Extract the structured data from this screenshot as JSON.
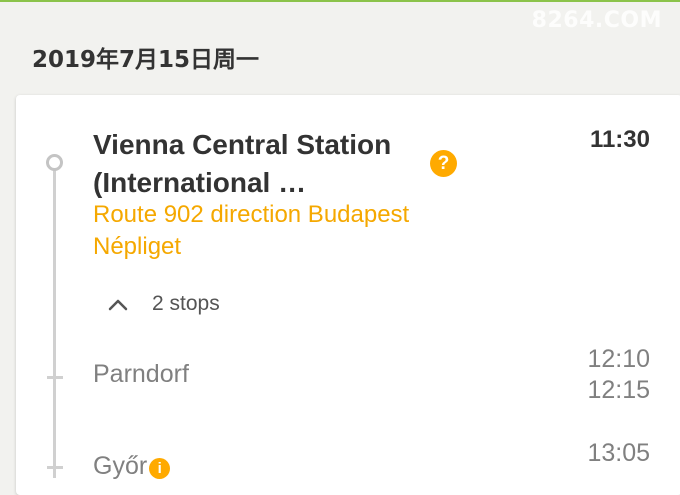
{
  "watermark": "8264.COM",
  "date_header": "2019年7月15日周一",
  "departure": {
    "station": "Vienna Central Station (International …",
    "time": "11:30",
    "help_icon": "?",
    "route": "Route 902 direction Budapest Népliget"
  },
  "stops_toggle": {
    "label": "2 stops",
    "icon": "chevron-up-icon"
  },
  "stops": [
    {
      "name": "Parndorf",
      "arrival": "12:10",
      "departure": "12:15"
    },
    {
      "name": "Győr",
      "arrival": "13:05",
      "info_icon": "i"
    }
  ],
  "colors": {
    "accent": "#f5a800",
    "icon_bg": "#ffaa00",
    "timeline": "#d0d0d0",
    "top_line": "#8bc34a"
  }
}
